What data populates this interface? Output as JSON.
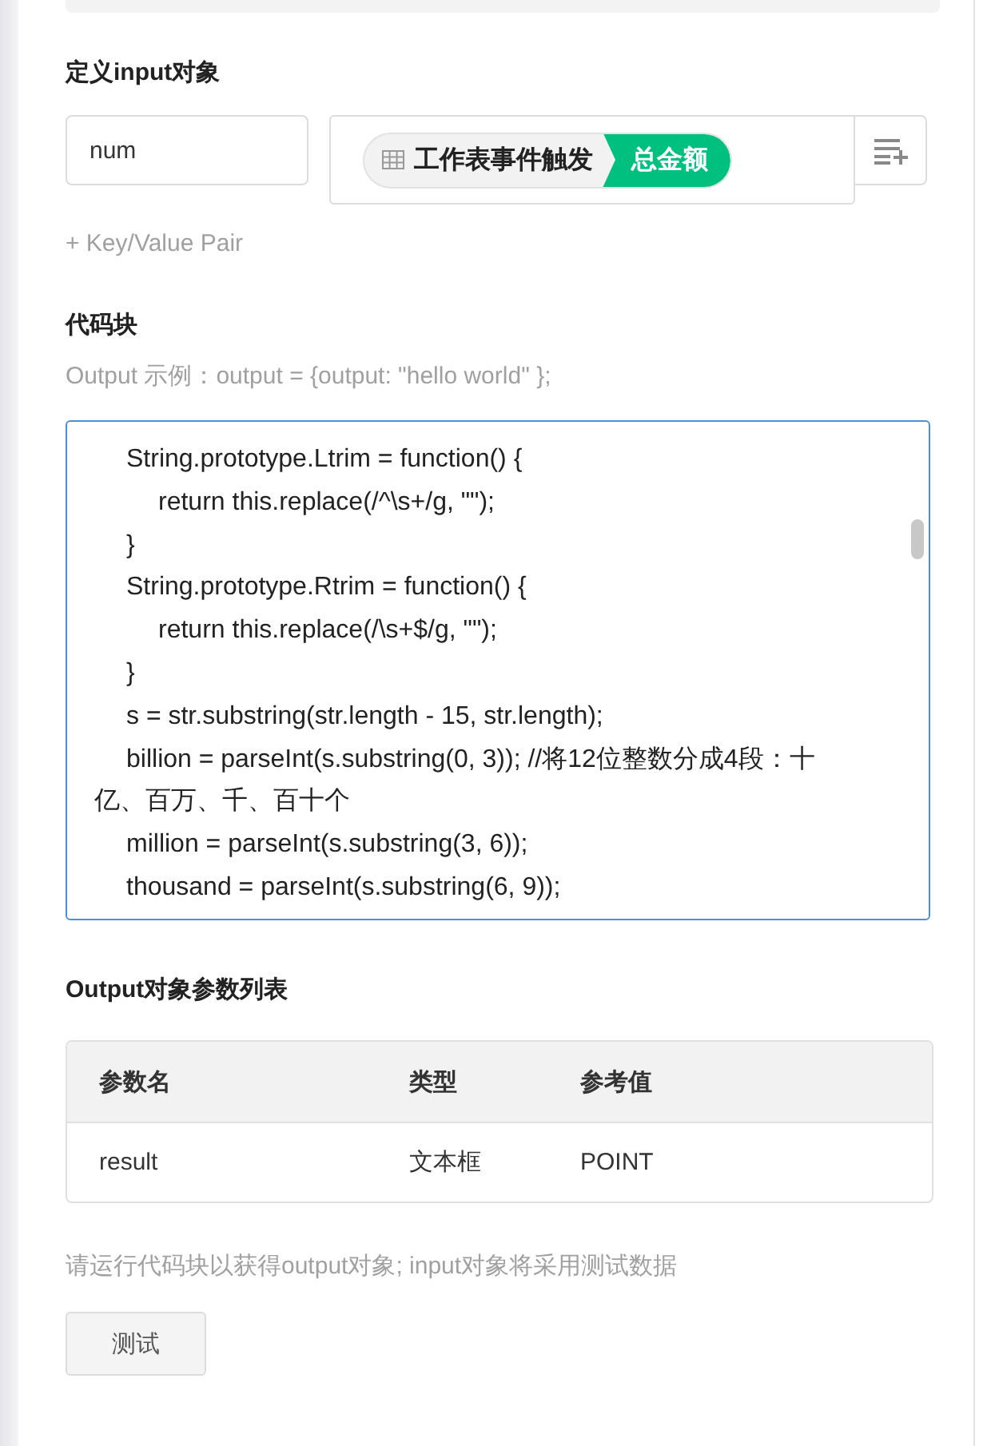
{
  "input_definition": {
    "title": "定义input对象",
    "key": {
      "value": "num"
    },
    "value_token": {
      "source": "工作表事件触发",
      "field": "总金额"
    },
    "add_pair": "+ Key/Value Pair"
  },
  "code_block": {
    "title": "代码块",
    "hint": "Output 示例：output = {output: \"hello world\" };",
    "lines": [
      "\tString.prototype.Ltrim = function() {",
      "\t\treturn this.replace(/^\\s+/g, \"\");",
      "\t}",
      "\tString.prototype.Rtrim = function() {",
      "\t\treturn this.replace(/\\s+$/g, \"\");",
      "\t}",
      "\ts = str.substring(str.length - 15, str.length);",
      "\tbillion = parseInt(s.substring(0, 3)); //将12位整数分成4段：十亿、百万、千、百十个",
      "\tmillion = parseInt(s.substring(3, 6));",
      "\tthousand = parseInt(s.substring(6, 9));"
    ]
  },
  "output_params": {
    "title": "Output对象参数列表",
    "columns": [
      "参数名",
      "类型",
      "参考值"
    ],
    "rows": [
      [
        "result",
        "文本框",
        "POINT"
      ]
    ]
  },
  "note": "请运行代码块以获得output对象; input对象将采用测试数据",
  "test_button": "测试"
}
